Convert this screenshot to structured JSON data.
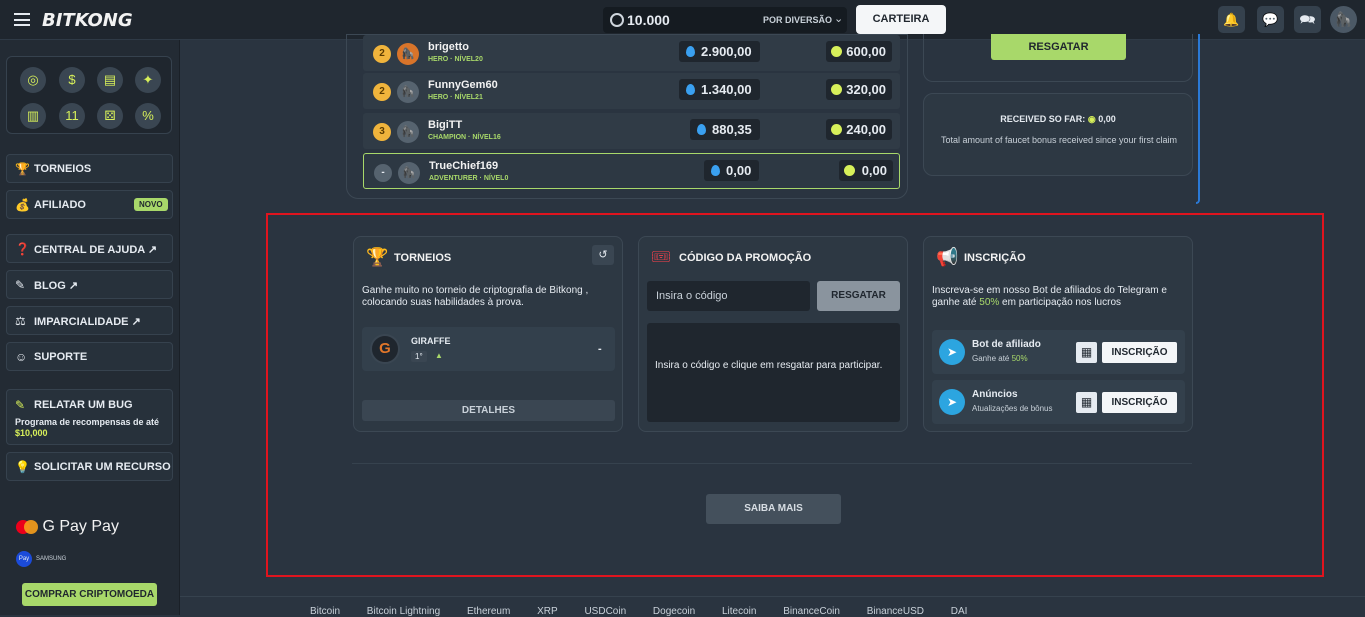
{
  "topbar": {
    "logo": "BITKONG",
    "balance": "10.000",
    "mode": "POR DIVERSÃO",
    "wallet_label": "CARTEIRA"
  },
  "sidebar": {
    "items": [
      {
        "label": "TORNEIOS",
        "icon": "trophy-icon"
      },
      {
        "label": "AFILIADO",
        "icon": "money-icon",
        "badge": "NOVO"
      },
      {
        "label": "CENTRAL DE AJUDA ↗",
        "icon": "help-icon"
      },
      {
        "label": "BLOG ↗",
        "icon": "pencil-icon"
      },
      {
        "label": "IMPARCIALIDADE ↗",
        "icon": "scales-icon"
      },
      {
        "label": "SUPORTE",
        "icon": "support-icon"
      }
    ],
    "bug": {
      "title": "RELATAR UM BUG",
      "desc": "Programa de recompensas de até",
      "amount": "$10,000"
    },
    "feature": {
      "label": "SOLICITAR UM RECURSO"
    },
    "payments": {
      "gpay": "G Pay",
      "apay": " Pay",
      "samsung": "SAMSUNG",
      "samsung_badge": "Pay"
    },
    "buy_crypto": "COMPRAR CRIPTOMOEDA"
  },
  "leaderboard": {
    "rows": [
      {
        "rank": "2",
        "name": "brigetto",
        "tier": "HERO · NÍVEL20",
        "wager": "2.900,00",
        "prize": "600,00",
        "medal_color": "#f0b43c"
      },
      {
        "rank": "2",
        "name": "FunnyGem60",
        "tier": "HERO · NÍVEL21",
        "wager": "1.340,00",
        "prize": "320,00",
        "medal_color": "#f0b43c"
      },
      {
        "rank": "3",
        "name": "BigiTT",
        "tier": "CHAMPION · NÍVEL16",
        "wager": "880,35",
        "prize": "240,00",
        "medal_color": "#f0b43c"
      },
      {
        "rank": "-",
        "name": "TrueChief169",
        "tier": "ADVENTURER · NÍVEL0",
        "wager": "0,00",
        "prize": "0,00",
        "medal_color": "#56636f"
      }
    ]
  },
  "faucet": {
    "redeem_label": "RESGATAR",
    "received_title": "RECEIVED SO FAR:",
    "received_value": "0,00",
    "received_desc": "Total amount of faucet bonus received since your first claim"
  },
  "tournaments": {
    "title": "TORNEIOS",
    "desc": "Ganhe muito no torneio de criptografia de Bitkong , colocando suas habilidades à prova.",
    "entry": {
      "name": "GIRAFFE",
      "rank": "1°",
      "value": "-",
      "initial": "G"
    },
    "details_label": "DETALHES"
  },
  "promo": {
    "title": "CÓDIGO DA PROMOÇÃO",
    "placeholder": "Insira o código",
    "button": "RESGATAR",
    "note": "Insira o código e clique em resgatar para participar."
  },
  "subscription": {
    "title": "INSCRIÇÃO",
    "desc_a": "Inscreva-se em nosso Bot de afiliados do Telegram e ganhe até ",
    "desc_highlight": "50%",
    "desc_b": " em participação nos lucros",
    "rows": [
      {
        "title": "Bot de afiliado",
        "sub_a": "Ganhe até ",
        "sub_b": "50%",
        "button": "INSCRIÇÃO"
      },
      {
        "title": "Anúncios",
        "sub_a": "Atualizações de bônus",
        "sub_b": "",
        "button": "INSCRIÇÃO"
      }
    ]
  },
  "saiba_mais": "SAIBA MAIS",
  "footer_coins": [
    "Bitcoin",
    "Bitcoin Lightning",
    "Ethereum",
    "XRP",
    "USDCoin",
    "Dogecoin",
    "Litecoin",
    "BinanceCoin",
    "BinanceUSD",
    "DAI"
  ],
  "colors": {
    "accent": "#a8d86a",
    "highlight_border": "#e0141e",
    "telegram": "#2ca5e0"
  }
}
